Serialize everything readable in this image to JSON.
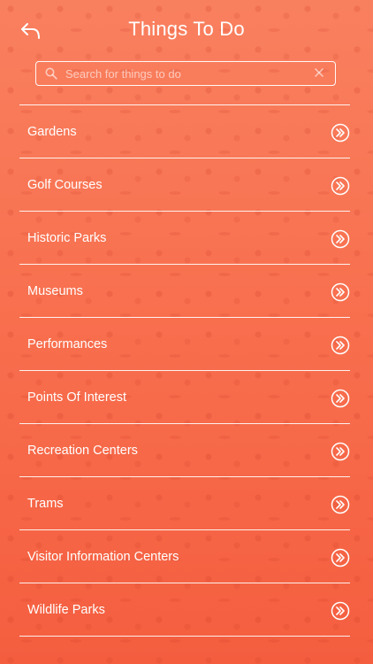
{
  "header": {
    "title": "Things To Do",
    "back_icon": "back-arrow-icon"
  },
  "search": {
    "placeholder": "Search for things to do",
    "value": "",
    "icon": "search-icon",
    "clear_icon": "close-icon"
  },
  "categories": [
    {
      "label": "Gardens",
      "icon": "double-chevron-right-icon"
    },
    {
      "label": "Golf Courses",
      "icon": "double-chevron-right-icon"
    },
    {
      "label": "Historic Parks",
      "icon": "double-chevron-right-icon"
    },
    {
      "label": "Museums",
      "icon": "double-chevron-right-icon"
    },
    {
      "label": "Performances",
      "icon": "double-chevron-right-icon"
    },
    {
      "label": "Points Of Interest",
      "icon": "double-chevron-right-icon"
    },
    {
      "label": "Recreation Centers",
      "icon": "double-chevron-right-icon"
    },
    {
      "label": "Trams",
      "icon": "double-chevron-right-icon"
    },
    {
      "label": "Visitor Information Centers",
      "icon": "double-chevron-right-icon"
    },
    {
      "label": "Wildlife Parks",
      "icon": "double-chevron-right-icon"
    }
  ],
  "colors": {
    "background_top": "#f9805f",
    "background_bottom": "#f45e3f",
    "foreground": "#ffffff"
  }
}
